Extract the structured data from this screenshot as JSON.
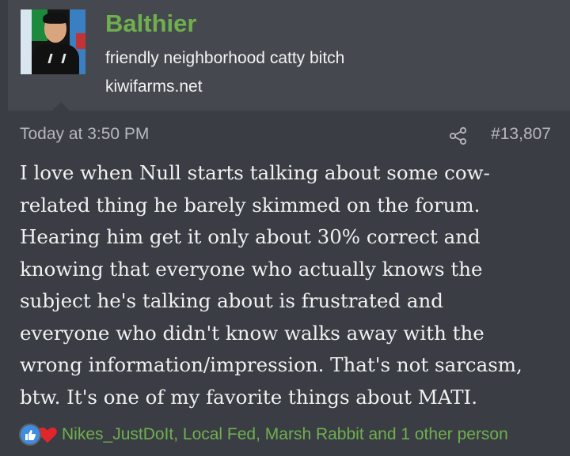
{
  "user": {
    "name": "Balthier",
    "title": "friendly neighborhood catty bitch",
    "site": "kiwifarms.net"
  },
  "post": {
    "date": "Today at 3:50 PM",
    "number": "#13,807",
    "body_lines": [
      "I love when Null starts talking about some cow-",
      "related thing he barely skimmed on the forum.",
      "Hearing him get it only about 30% correct and",
      "knowing that everyone who actually knows the",
      "subject he's talking about is frustrated and",
      "everyone who didn't know walks away with the",
      "wrong information/impression. That's not sarcasm,",
      "btw. It's one of my favorite things about MATI."
    ]
  },
  "reactions": {
    "icons": [
      "like-icon",
      "heart-icon"
    ],
    "users_text": "Nikes_JustDoIt, Local Fed, Marsh Rabbit and 1 other person"
  },
  "colors": {
    "background": "#3a3d44",
    "header_background": "#45484f",
    "username": "#6fb04d",
    "link": "#6fb04d",
    "like": "#3d8ee0",
    "heart": "#e0262a"
  }
}
